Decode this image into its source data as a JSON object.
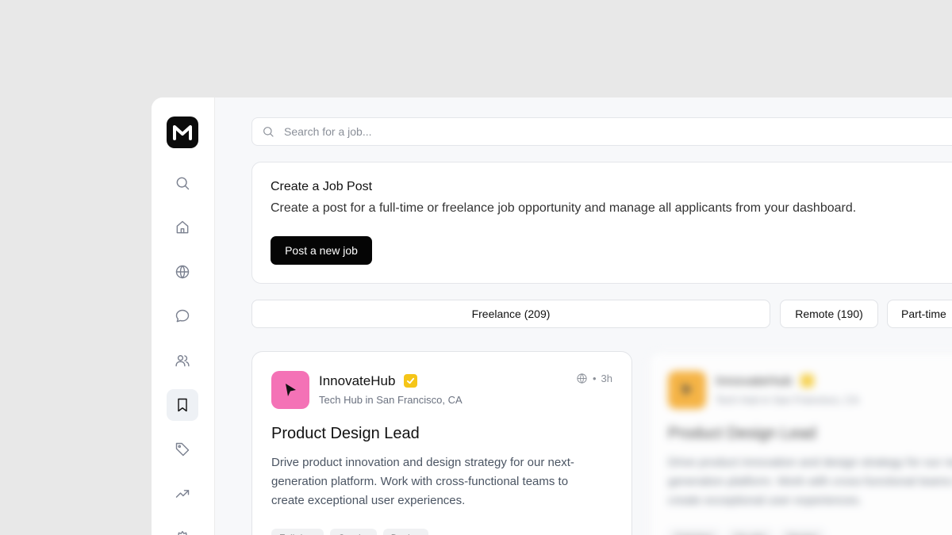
{
  "brand": {
    "logo_letter": "M"
  },
  "sidebar": {
    "items": [
      {
        "icon": "search-icon",
        "active": false
      },
      {
        "icon": "home-icon",
        "active": false
      },
      {
        "icon": "globe-icon",
        "active": false
      },
      {
        "icon": "chat-icon",
        "active": false
      },
      {
        "icon": "users-icon",
        "active": false
      },
      {
        "icon": "bookmark-icon",
        "active": true
      },
      {
        "icon": "tag-icon",
        "active": false
      },
      {
        "icon": "trending-icon",
        "active": false
      },
      {
        "icon": "settings-icon",
        "active": false
      }
    ]
  },
  "search": {
    "placeholder": "Search for a job..."
  },
  "create_post": {
    "title": "Create a Job Post",
    "description": "Create a post for a full-time or freelance job opportunity and manage all applicants from your dashboard.",
    "button_label": "Post a new job"
  },
  "filters": [
    {
      "label": "Freelance (209)"
    },
    {
      "label": "Remote (190)"
    },
    {
      "label": "Part-time"
    }
  ],
  "jobs": [
    {
      "company": "InnovateHub",
      "verified": true,
      "location": "Tech Hub in San Francisco, CA",
      "posted": "3h",
      "title": "Product Design Lead",
      "description": "Drive product innovation and design strategy for our next-generation platform. Work with cross-functional teams to create exceptional user experiences.",
      "logo_color": "#f472b6",
      "tags": [
        "Full-time",
        "On-site",
        "Design"
      ]
    },
    {
      "company": "InnovateHub",
      "verified": true,
      "location": "Tech Hub in San Francisco, CA",
      "title": "Product Design Lead",
      "description": "Drive product innovation and design strategy for our next-generation platform. Work with cross-functional teams to create exceptional user experiences.",
      "logo_color": "#f59e0b",
      "tags": [
        "Full-time",
        "On-site",
        "Design"
      ]
    }
  ],
  "colors": {
    "accent": "#050505",
    "verified": "#f5c518"
  }
}
